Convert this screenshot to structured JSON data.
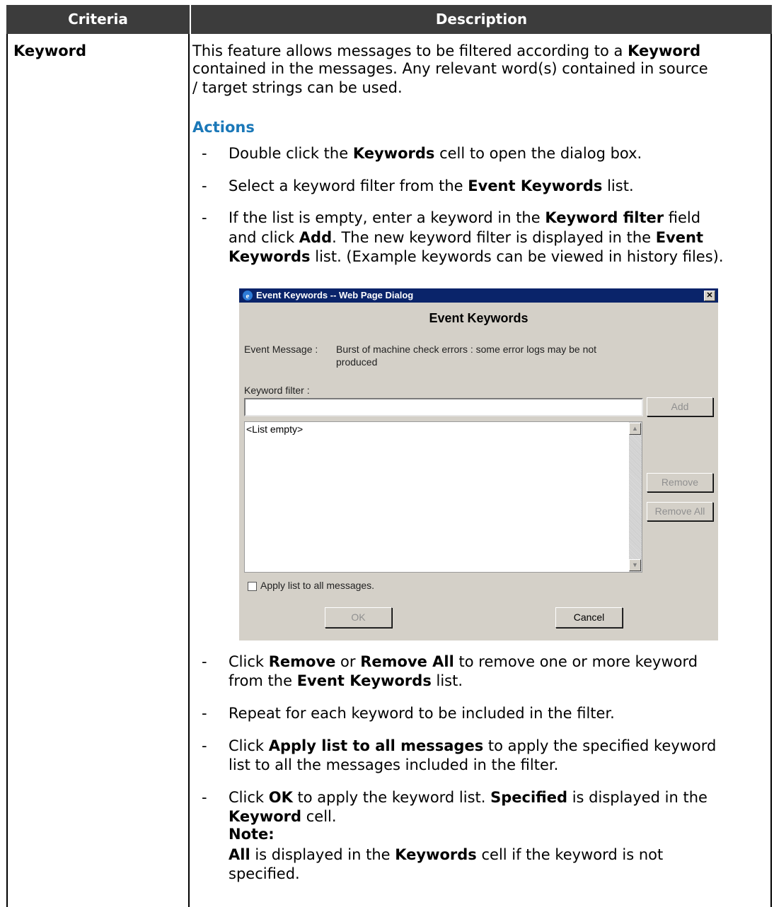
{
  "table": {
    "header_criteria": "Criteria",
    "header_description": "Description",
    "row_criteria": "Keyword"
  },
  "intro": {
    "line1_a": "This feature allows messages to be filtered according to a ",
    "line1_b": "Keyword",
    "line2": "contained in the messages. Any relevant word(s) contained in source",
    "line3": "/ target strings can be used."
  },
  "actions_heading": "Actions",
  "steps": {
    "s1": [
      "Double click the ",
      "Keywords",
      " cell to open the dialog box."
    ],
    "s2": [
      "Select a keyword filter from the ",
      "Event Keywords",
      " list."
    ],
    "s3": {
      "l1": [
        "If the list is empty, enter a keyword in the ",
        "Keyword filter",
        " field"
      ],
      "l2": [
        "and click ",
        "Add",
        ". The new keyword filter is displayed in the ",
        "Event"
      ],
      "l3": [
        "Keywords",
        " list. (Example keywords can be viewed in history files)."
      ]
    },
    "s4": {
      "l1": [
        "Click ",
        "Remove",
        " or ",
        "Remove All",
        " to remove one or more keyword"
      ],
      "l2": [
        "from the ",
        "Event Keywords",
        " list."
      ]
    },
    "s5": "Repeat for each keyword to be included in the filter.",
    "s6": {
      "l1": [
        "Click ",
        "Apply list to all messages",
        " to apply the specified keyword"
      ],
      "l2": "list to all the messages included in the filter."
    },
    "s7": {
      "l1": [
        "Click ",
        "OK",
        " to apply the keyword list. ",
        "Specified",
        " is displayed in the"
      ],
      "l2": [
        "Keyword",
        " cell."
      ],
      "note": "Note:",
      "l3": [
        "All",
        " is displayed in the ",
        "Keywords",
        " cell if the keyword is not"
      ],
      "l4": "specified."
    }
  },
  "dialog": {
    "title": "Event Keywords -- Web Page Dialog",
    "heading": "Event Keywords",
    "event_message_label": "Event Message :",
    "event_message_l1": "Burst of machine check errors : some error logs may be not",
    "event_message_l2": "produced",
    "keyword_filter_label": "Keyword filter :",
    "keyword_filter_value": "",
    "add": "Add",
    "list_empty": "<List empty>",
    "remove": "Remove",
    "remove_all": "Remove All",
    "apply_all": "Apply list to all messages.",
    "ok": "OK",
    "cancel": "Cancel",
    "colors": {
      "titlebar": "#0a246a",
      "face": "#d4d0c8"
    }
  },
  "colors": {
    "header_bg": "#3c3c3c",
    "actions": "#1b78b8"
  }
}
